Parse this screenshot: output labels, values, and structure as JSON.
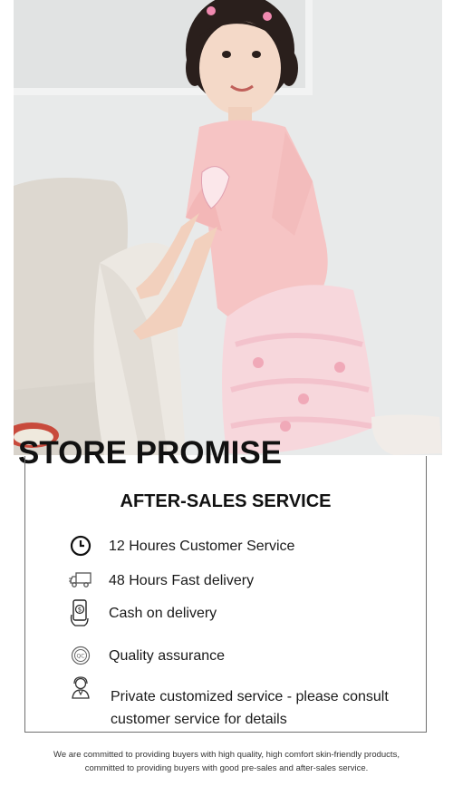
{
  "hero": {
    "image": "girl-in-pink-outfit-photo"
  },
  "promise": {
    "title": "STORE PROMISE"
  },
  "after_sales": {
    "title": "AFTER-SALES SERVICE",
    "items": [
      {
        "icon": "clock-icon",
        "label": "12 Houres Customer Service"
      },
      {
        "icon": "truck-icon",
        "label": "48 Hours Fast delivery"
      },
      {
        "icon": "cash-phone-icon",
        "label": "Cash on delivery"
      },
      {
        "icon": "quality-badge-icon",
        "label": "Quality assurance"
      },
      {
        "icon": "agent-icon",
        "label": "Private customized service - please consult customer service for details"
      }
    ]
  },
  "footer": {
    "line1": "We are committed to providing buyers with high quality, high comfort skin-friendly products,",
    "line2": "committed to providing buyers with good pre-sales and after-sales service."
  }
}
